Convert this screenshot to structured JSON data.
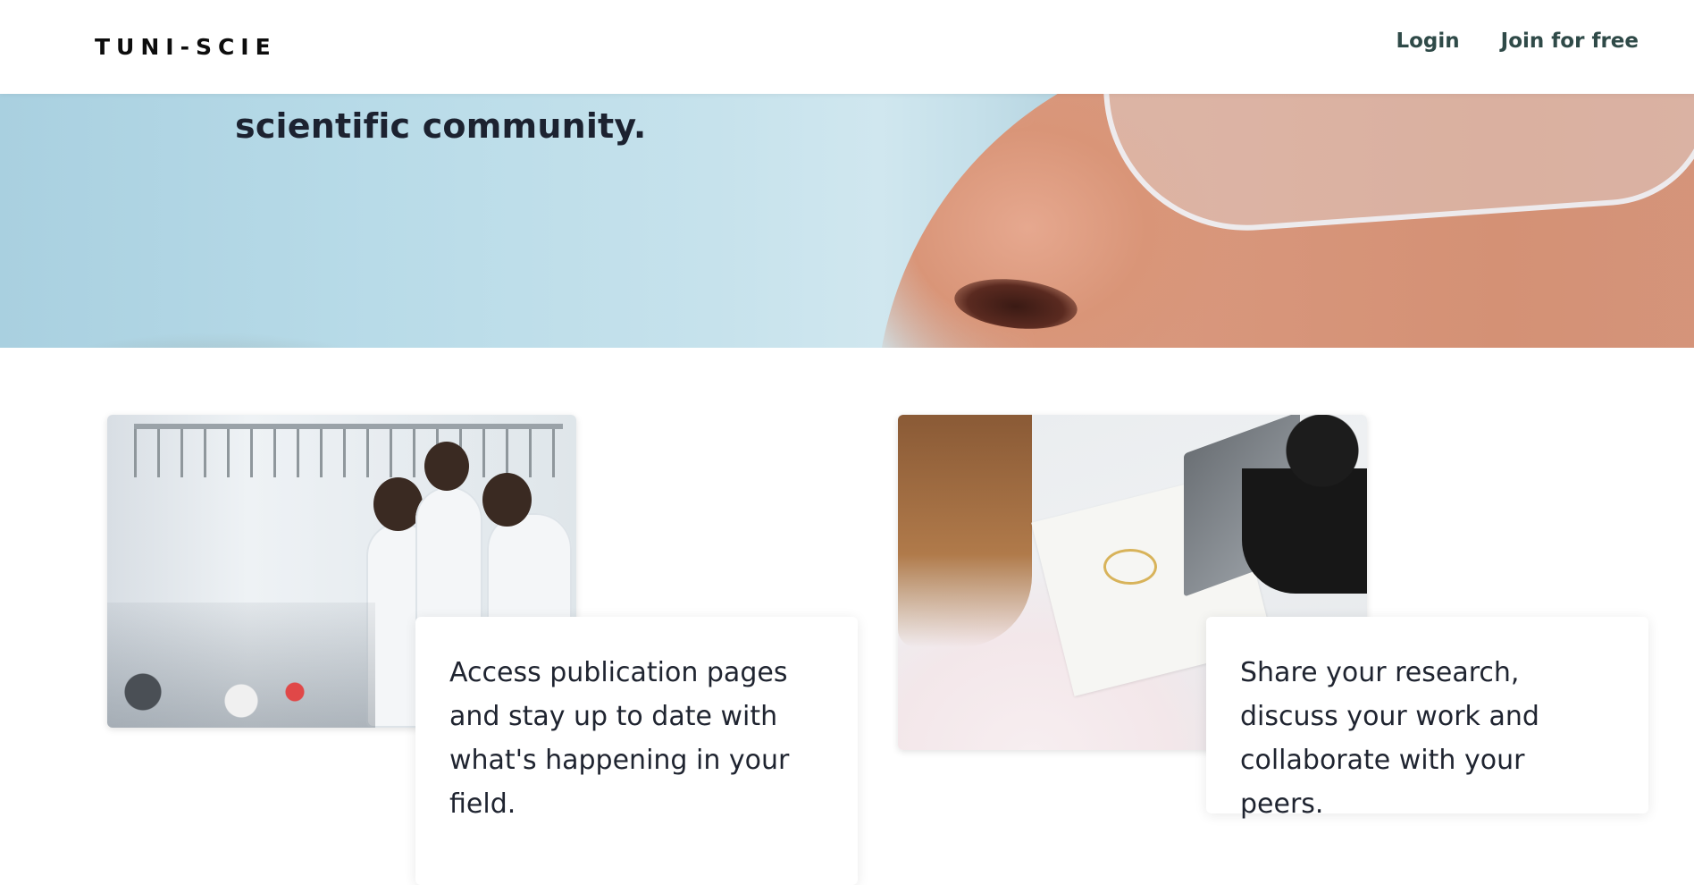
{
  "header": {
    "logo": "TUNI-SCIE",
    "nav": {
      "login": "Login",
      "join": "Join for free"
    }
  },
  "hero": {
    "visible_text": "scientific community."
  },
  "features": [
    {
      "image_alt_icon": "lab-photo",
      "text": "Access publication pages and stay up to date with what's happening in your field."
    },
    {
      "image_alt_icon": "collaboration-photo",
      "text": "Share your research, discuss your work and collaborate with your peers."
    }
  ],
  "colors": {
    "nav_link": "#2f4a48",
    "text": "#1f2430",
    "background": "#ffffff"
  }
}
